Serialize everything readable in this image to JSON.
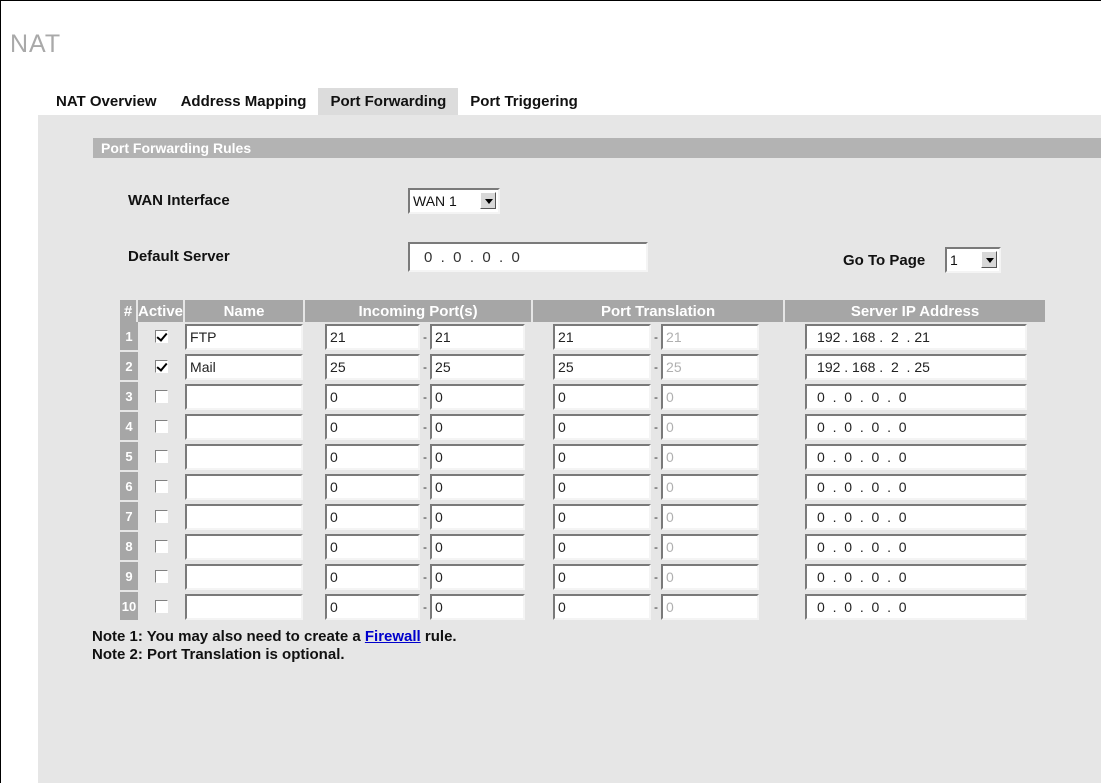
{
  "page": {
    "title": "NAT"
  },
  "tabs": [
    {
      "label": "NAT Overview",
      "active": false
    },
    {
      "label": "Address Mapping",
      "active": false
    },
    {
      "label": "Port Forwarding",
      "active": true
    },
    {
      "label": "Port Triggering",
      "active": false
    }
  ],
  "section": {
    "title": "Port Forwarding Rules"
  },
  "form": {
    "wan_interface_label": "WAN Interface",
    "wan_interface_value": "WAN 1",
    "default_server_label": "Default Server",
    "default_server_value": "0  .  0  .  0  .  0",
    "goto_page_label": "Go To Page",
    "goto_page_value": "1"
  },
  "table": {
    "headers": {
      "num": "#",
      "active": "Active",
      "name": "Name",
      "incoming": "Incoming Port(s)",
      "translation": "Port Translation",
      "server_ip": "Server IP Address"
    },
    "rows": [
      {
        "num": "1",
        "active": true,
        "name": "FTP",
        "in_start": "21",
        "in_end": "21",
        "tr_start": "21",
        "tr_end": "21",
        "ip": "192 . 168 .  2  . 21"
      },
      {
        "num": "2",
        "active": true,
        "name": "Mail",
        "in_start": "25",
        "in_end": "25",
        "tr_start": "25",
        "tr_end": "25",
        "ip": "192 . 168 .  2  . 25"
      },
      {
        "num": "3",
        "active": false,
        "name": "",
        "in_start": "0",
        "in_end": "0",
        "tr_start": "0",
        "tr_end": "0",
        "ip": "0  .  0  .  0  .  0"
      },
      {
        "num": "4",
        "active": false,
        "name": "",
        "in_start": "0",
        "in_end": "0",
        "tr_start": "0",
        "tr_end": "0",
        "ip": "0  .  0  .  0  .  0"
      },
      {
        "num": "5",
        "active": false,
        "name": "",
        "in_start": "0",
        "in_end": "0",
        "tr_start": "0",
        "tr_end": "0",
        "ip": "0  .  0  .  0  .  0"
      },
      {
        "num": "6",
        "active": false,
        "name": "",
        "in_start": "0",
        "in_end": "0",
        "tr_start": "0",
        "tr_end": "0",
        "ip": "0  .  0  .  0  .  0"
      },
      {
        "num": "7",
        "active": false,
        "name": "",
        "in_start": "0",
        "in_end": "0",
        "tr_start": "0",
        "tr_end": "0",
        "ip": "0  .  0  .  0  .  0"
      },
      {
        "num": "8",
        "active": false,
        "name": "",
        "in_start": "0",
        "in_end": "0",
        "tr_start": "0",
        "tr_end": "0",
        "ip": "0  .  0  .  0  .  0"
      },
      {
        "num": "9",
        "active": false,
        "name": "",
        "in_start": "0",
        "in_end": "0",
        "tr_start": "0",
        "tr_end": "0",
        "ip": "0  .  0  .  0  .  0"
      },
      {
        "num": "10",
        "active": false,
        "name": "",
        "in_start": "0",
        "in_end": "0",
        "tr_start": "0",
        "tr_end": "0",
        "ip": "0  .  0  .  0  .  0"
      }
    ]
  },
  "notes": {
    "note1_prefix": "Note 1: You may also need to create a ",
    "note1_link": "Firewall",
    "note1_suffix": " rule.",
    "note2": "Note 2: Port Translation is optional."
  }
}
